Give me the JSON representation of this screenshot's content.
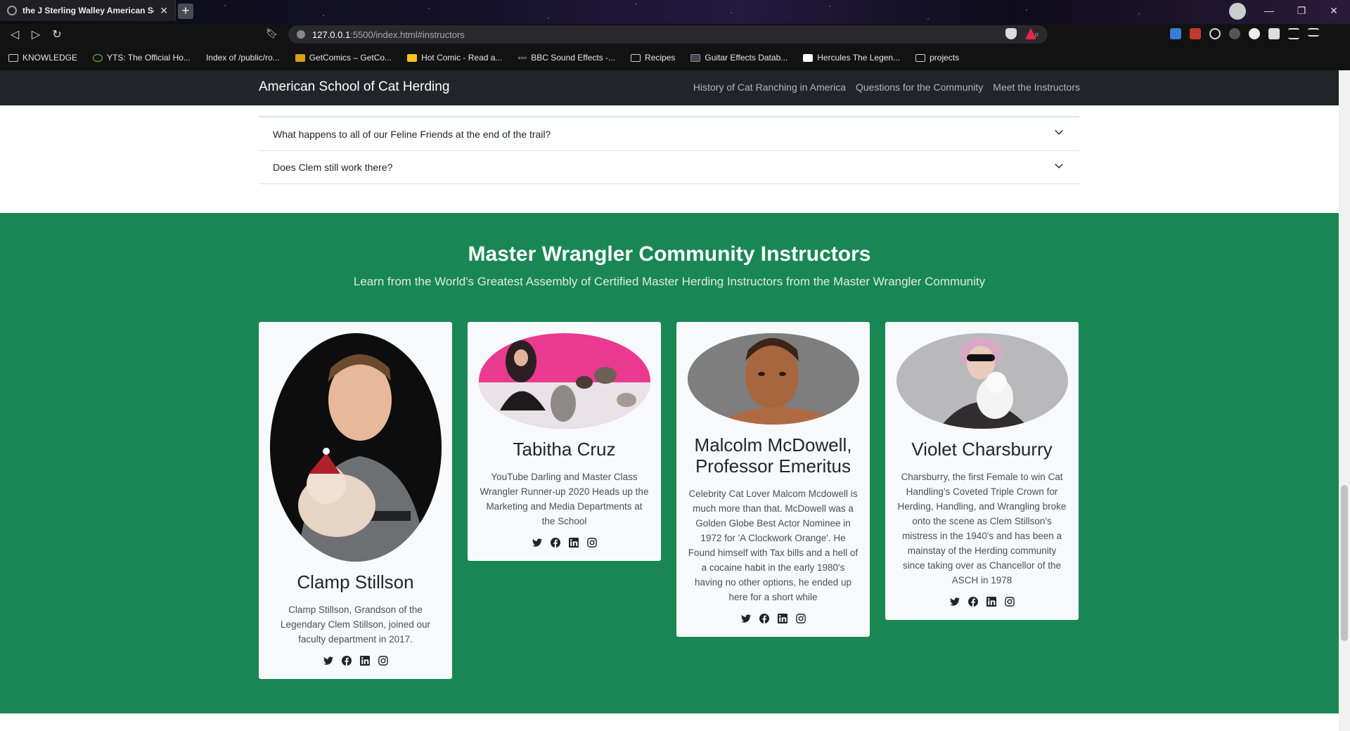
{
  "browser": {
    "tab_title": "the J Sterling Walley American Sc",
    "url_host": "127.0.0.1",
    "url_path": ":5500/index.html#instructors",
    "bookmarks": [
      {
        "label": "KNOWLEDGE"
      },
      {
        "label": "YTS: The Official Ho..."
      },
      {
        "label": "Index of /public/ro..."
      },
      {
        "label": "GetComics – GetCo..."
      },
      {
        "label": "Hot Comic - Read a..."
      },
      {
        "label": "BBC Sound Effects -..."
      },
      {
        "label": "Recipes"
      },
      {
        "label": "Guitar Effects Datab..."
      },
      {
        "label": "Hercules The Legen..."
      },
      {
        "label": "projects"
      }
    ]
  },
  "site": {
    "brand": "American School of Cat Herding",
    "nav": [
      {
        "label": "History of Cat Ranching in America"
      },
      {
        "label": "Questions for the Community"
      },
      {
        "label": "Meet the Instructors"
      }
    ]
  },
  "faq": [
    {
      "question": "What happens to all of our Feline Friends at the end of the trail?"
    },
    {
      "question": "Does Clem still work there?"
    }
  ],
  "instructors": {
    "title": "Master Wrangler Community Instructors",
    "subtitle": "Learn from the World's Greatest Assembly of Certified Master Herding Instructors from the Master Wrangler Community",
    "cards": [
      {
        "name": "Clamp Stillson",
        "bio": "Clamp Stillson, Grandson of the Legendary Clem Stillson, joined our faculty department in 2017."
      },
      {
        "name": "Tabitha Cruz",
        "bio": "YouTube Darling and Master Class Wrangler Runner-up 2020 Heads up the Marketing and Media Departments at the School"
      },
      {
        "name": "Malcolm McDowell, Professor Emeritus",
        "bio": "Celebrity Cat Lover Malcom Mcdowell is much more than that. McDowell was a Golden Globe Best Actor Nominee in 1972 for 'A Clockwork Orange'. He Found himself with Tax bills and a hell of a cocaine habit in the early 1980's having no other options, he ended up here for a short while"
      },
      {
        "name": "Violet Charsburry",
        "bio": "Charsburry, the first Female to win Cat Handling's Coveted Triple Crown for Herding, Handling, and Wrangling broke onto the scene as Clem Stillson's mistress in the 1940's and has been a mainstay of the Herding community since taking over as Chancellor of the ASCH in 1978"
      }
    ]
  },
  "colors": {
    "section_green": "#198754",
    "navbar": "#212529",
    "card_bg": "#f8f9fa"
  },
  "icons": [
    "twitter-icon",
    "facebook-icon",
    "linkedin-icon",
    "instagram-icon",
    "chevron-down-icon"
  ]
}
